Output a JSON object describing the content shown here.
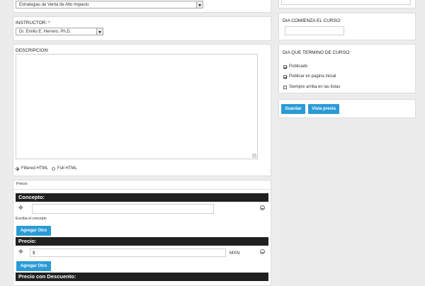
{
  "course_select": {
    "value": "Estrategias de Venta de Alto Impacto"
  },
  "instructor": {
    "label": "INSTRUCTOR:",
    "required_mark": "*",
    "value": "Dr. Emilio E. Herrero, Ph.D."
  },
  "descripcion": {
    "label": "DESCRIPCION:",
    "format_filtered": "Filtered HTML",
    "format_full": "Full HTML",
    "selected_format": "Filtered HTML"
  },
  "precio_section": {
    "title": "Precio",
    "concepto": {
      "label": "Concepto:",
      "value": "",
      "hint": "Escriba el concepto",
      "add_button": "Agregar Otro"
    },
    "precio": {
      "label": "Precio:",
      "currency_symbol": "$",
      "value": "",
      "currency": "MXN",
      "add_button": "Agregar Otro"
    },
    "descuento": {
      "label": "Precio con Descuento:"
    }
  },
  "sidebar": {
    "start": {
      "label": "DIA COMIENZA EL CURSO:",
      "value": ""
    },
    "end": {
      "label": "DIA QUE TERMINO DE CURSO:"
    },
    "options": [
      {
        "label": "Publicado",
        "checked": true
      },
      {
        "label": "Publicar en pagina inicial",
        "checked": true
      },
      {
        "label": "Siempre arriba en las listas",
        "checked": false
      }
    ],
    "save_button": "Guardar",
    "preview_button": "Vista previa"
  }
}
